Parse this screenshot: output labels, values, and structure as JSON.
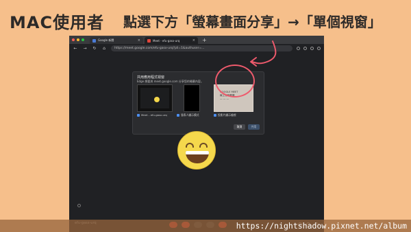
{
  "heading": {
    "tag": "MAC使用者",
    "instruction": "點選下方「螢幕畫面分享」→「單個視窗」"
  },
  "browser": {
    "tabs": [
      {
        "label": "Google 新聞",
        "active": false
      },
      {
        "label": "Meet - efu-gasx-urq",
        "active": true
      }
    ],
    "new_tab_icon": "plus-icon",
    "address": "https://meet.google.com/efu-gasx-urq?pli=1&authuser=...",
    "nav": {
      "back": "←",
      "forward": "→",
      "reload": "↻",
      "home": "⌂"
    }
  },
  "dialog": {
    "title": "共用應用程式視窗",
    "subtitle": "Edge 想要與 meet.google.com 分享您的螢幕內容。",
    "windows": [
      {
        "label": "Meet – efu-gasx-urq"
      },
      {
        "label": "發表人顯示模式"
      },
      {
        "label": "投影片顯示檢視"
      }
    ],
    "selected_thumb_text": [
      "GOOGLE MEET",
      "線上會議教學",
      "— — —"
    ],
    "buttons": {
      "cancel": "取消",
      "share": "共用"
    }
  },
  "meet": {
    "code": "efu-gasx-urq"
  },
  "footer": {
    "url": "https://nightshadow.pixnet.net/album"
  },
  "colors": {
    "background": "#f6bf8b",
    "annotation": "#ee5a6c",
    "browser_bg": "#202124"
  }
}
